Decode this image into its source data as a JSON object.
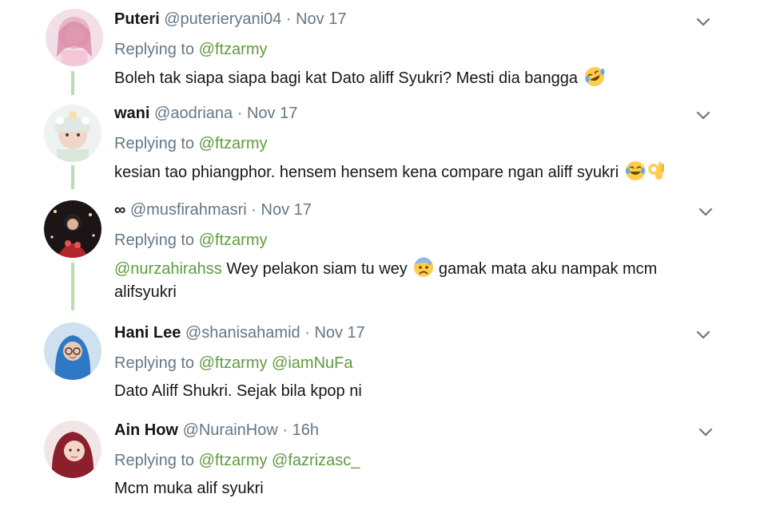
{
  "tweets": [
    {
      "name": "Puteri",
      "handle": "@puterieryani04",
      "separator": "·",
      "time": "Nov 17",
      "replying_label": "Replying to",
      "replying_to": [
        "@ftzarmy"
      ],
      "mention": "",
      "text": "Boleh tak siapa siapa bagi kat Dato aliff Syukri?  Mesti dia bangga",
      "text_line2": "",
      "emojis": [
        "rofl-emoji"
      ]
    },
    {
      "name": "wani",
      "handle": "@aodriana",
      "separator": "·",
      "time": "Nov 17",
      "replying_label": "Replying to",
      "replying_to": [
        "@ftzarmy"
      ],
      "mention": "",
      "text": "kesian tao phiangphor. hensem hensem kena compare ngan aliff syukri",
      "text_line2": "",
      "emojis": [
        "tears-of-joy-emoji",
        "ok-hand-emoji"
      ]
    },
    {
      "name": "∞",
      "handle": "@musfirahmasri",
      "separator": "·",
      "time": "Nov 17",
      "replying_label": "Replying to",
      "replying_to": [
        "@ftzarmy"
      ],
      "mention": "@nurzahirahss",
      "text": " Wey pelakon siam tu wey",
      "text_after_emoji": " gamak mata aku nampak mcm",
      "text_line2": "alifsyukri",
      "emojis": [
        "anxious-sweat-emoji"
      ]
    },
    {
      "name": "Hani Lee",
      "handle": "@shanisahamid",
      "separator": "·",
      "time": "Nov 17",
      "replying_label": "Replying to",
      "replying_to": [
        "@ftzarmy",
        "@iamNuFa"
      ],
      "mention": "",
      "text": "Dato Aliff Shukri.  Sejak bila kpop ni",
      "text_line2": "",
      "emojis": []
    },
    {
      "name": "Ain How",
      "handle": "@NurainHow",
      "separator": "·",
      "time": "16h",
      "replying_label": "Replying to",
      "replying_to": [
        "@ftzarmy",
        "@fazrizasc_"
      ],
      "mention": "",
      "text": "Mcm muka alif syukri",
      "text_line2": "",
      "emojis": []
    }
  ],
  "colors": {
    "link": "#5f9b3e",
    "muted": "#657786",
    "thread_line": "#b7dcb0",
    "text": "#14171a"
  }
}
